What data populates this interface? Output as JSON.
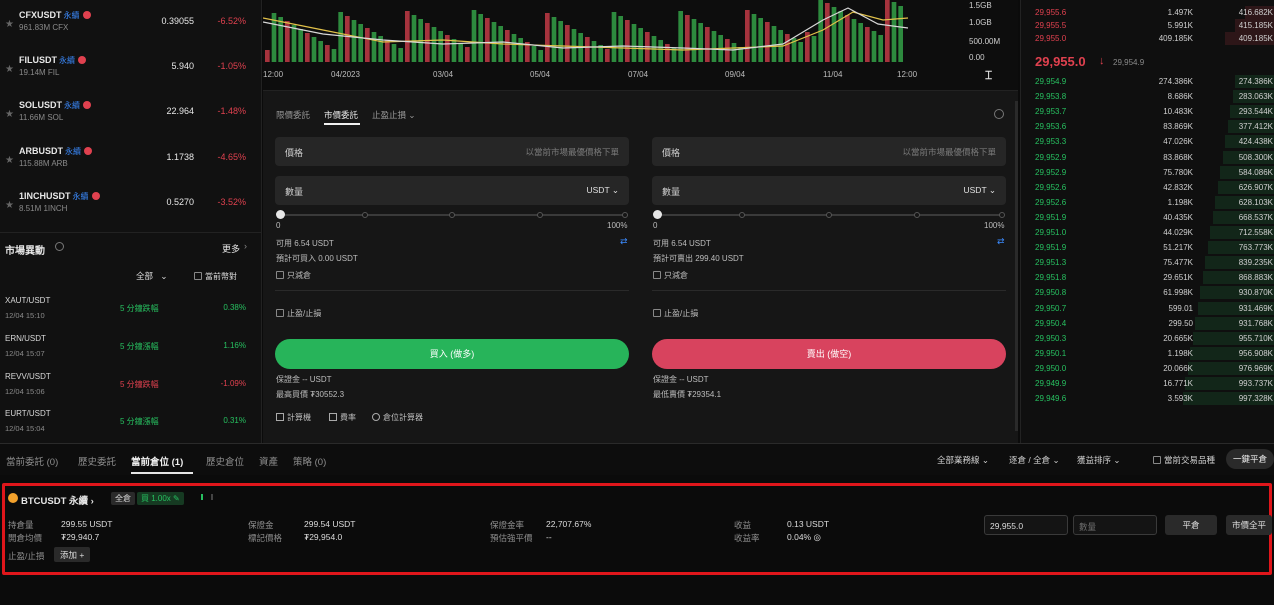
{
  "markets": [
    {
      "symbol": "CFXUSDT",
      "tag": "永續",
      "volume": "961.83M CFX",
      "price": "0.39055",
      "change": "-6.52%"
    },
    {
      "symbol": "FILUSDT",
      "tag": "永續",
      "volume": "19.14M FIL",
      "price": "5.940",
      "change": "-1.05%"
    },
    {
      "symbol": "SOLUSDT",
      "tag": "永續",
      "volume": "11.66M SOL",
      "price": "22.964",
      "change": "-1.48%"
    },
    {
      "symbol": "ARBUSDT",
      "tag": "永續",
      "volume": "115.88M ARB",
      "price": "1.1738",
      "change": "-4.65%"
    },
    {
      "symbol": "1INCHUSDT",
      "tag": "永續",
      "volume": "8.51M 1INCH",
      "price": "0.5270",
      "change": "-3.52%"
    }
  ],
  "movers": {
    "title": "市場異動",
    "more": "更多",
    "filter_all": "全部",
    "filter_current": "當前幣對",
    "rows": [
      {
        "pair": "XAUT/USDT",
        "time": "12/04 15:10",
        "desc": "5 分鐘跌幅",
        "pct": "0.38%",
        "color": "green"
      },
      {
        "pair": "ERN/USDT",
        "time": "12/04 15:07",
        "desc": "5 分鐘漲幅",
        "pct": "1.16%",
        "color": "green"
      },
      {
        "pair": "REVV/USDT",
        "time": "12/04 15:06",
        "desc": "5 分鐘跌幅",
        "pct": "-1.09%",
        "color": "red"
      },
      {
        "pair": "EURT/USDT",
        "time": "12/04 15:04",
        "desc": "5 分鐘漲幅",
        "pct": "0.31%",
        "color": "green"
      }
    ]
  },
  "chart": {
    "x_labels": [
      "12:00",
      "04/2023",
      "03/04",
      "05/04",
      "07/04",
      "09/04",
      "11/04",
      "12:00"
    ],
    "y_labels": [
      "1.5GB",
      "1.0GB",
      "500.00M",
      "0.00"
    ]
  },
  "order": {
    "tabs": [
      "限價委託",
      "市價委託",
      "止盈止損"
    ],
    "active_tab": "市價委託",
    "buy": {
      "price_label": "價格",
      "price_placeholder": "以當前市場最優價格下單",
      "qty_label": "數量",
      "unit": "USDT",
      "pct_min": "0",
      "pct_max": "100%",
      "available": "可用 6.54 USDT",
      "estimate": "預計可買入 0.00 USDT",
      "reduce_only": "只減倉",
      "tpsl": "止盈/止損",
      "button": "買入 (做多)",
      "margin": "保證金 -- USDT",
      "max_price": "最高買價 ₮30552.3"
    },
    "sell": {
      "price_label": "價格",
      "price_placeholder": "以當前市場最優價格下單",
      "qty_label": "數量",
      "unit": "USDT",
      "pct_min": "0",
      "pct_max": "100%",
      "available": "可用 6.54 USDT",
      "estimate": "預計可賣出 299.40 USDT",
      "reduce_only": "只減倉",
      "tpsl": "止盈/止損",
      "button": "賣出 (做空)",
      "margin": "保證金 -- USDT",
      "min_price": "最低賣價 ₮29354.1"
    },
    "tools": [
      "計算機",
      "費率",
      "倉位計算器"
    ]
  },
  "orderbook": {
    "asks": [
      {
        "price": "29,955.6",
        "size": "1.497K",
        "total": "416.682K"
      },
      {
        "price": "29,955.5",
        "size": "5.991K",
        "total": "415.185K"
      },
      {
        "price": "29,955.0",
        "size": "409.185K",
        "total": "409.185K"
      }
    ],
    "last_price": "29,955.0",
    "last_arrow": "↓",
    "mark_price": "29,954.9",
    "bids": [
      {
        "price": "29,954.9",
        "size": "274.386K",
        "total": "274.386K"
      },
      {
        "price": "29,953.8",
        "size": "8.686K",
        "total": "283.063K"
      },
      {
        "price": "29,953.7",
        "size": "10.483K",
        "total": "293.544K"
      },
      {
        "price": "29,953.6",
        "size": "83.869K",
        "total": "377.412K"
      },
      {
        "price": "29,953.3",
        "size": "47.026K",
        "total": "424.438K"
      },
      {
        "price": "29,952.9",
        "size": "83.868K",
        "total": "508.300K"
      },
      {
        "price": "29,952.9",
        "size": "75.780K",
        "total": "584.086K"
      },
      {
        "price": "29,952.6",
        "size": "42.832K",
        "total": "626.907K"
      },
      {
        "price": "29,952.6",
        "size": "1.198K",
        "total": "628.103K"
      },
      {
        "price": "29,951.9",
        "size": "40.435K",
        "total": "668.537K"
      },
      {
        "price": "29,951.0",
        "size": "44.029K",
        "total": "712.558K"
      },
      {
        "price": "29,951.9",
        "size": "51.217K",
        "total": "763.773K"
      },
      {
        "price": "29,951.3",
        "size": "75.477K",
        "total": "839.235K"
      },
      {
        "price": "29,951.8",
        "size": "29.651K",
        "total": "868.883K"
      },
      {
        "price": "29,950.8",
        "size": "61.998K",
        "total": "930.870K"
      },
      {
        "price": "29,950.7",
        "size": "599.01",
        "total": "931.469K"
      },
      {
        "price": "29,950.4",
        "size": "299.50",
        "total": "931.768K"
      },
      {
        "price": "29,950.3",
        "size": "20.665K",
        "total": "955.710K"
      },
      {
        "price": "29,950.1",
        "size": "1.198K",
        "total": "956.908K"
      },
      {
        "price": "29,950.0",
        "size": "20.066K",
        "total": "976.969K"
      },
      {
        "price": "29,949.9",
        "size": "16.771K",
        "total": "993.737K"
      },
      {
        "price": "29,949.6",
        "size": "3.593K",
        "total": "997.328K"
      }
    ]
  },
  "bottom_tabs": {
    "tabs": [
      "當前委託 (0)",
      "歷史委託",
      "當前倉位 (1)",
      "歷史倉位",
      "資產",
      "策略 (0)"
    ],
    "active": "當前倉位 (1)",
    "filters": [
      "全部業務線",
      "逐倉 / 全倉",
      "獲益排序"
    ],
    "current_only": "當前交易品種",
    "close_all": "一鍵平倉"
  },
  "position": {
    "symbol": "BTCUSDT 永續",
    "mode": "全倉",
    "leverage": "買 1.00x",
    "labels": {
      "size": "持倉量",
      "entry": "開倉均價",
      "margin": "保證金",
      "mark": "標記價格",
      "margin_ratio": "保證金率",
      "liq": "預估強平價",
      "pnl": "收益",
      "roe": "收益率",
      "tpsl": "止盈/止損"
    },
    "values": {
      "size": "299.55 USDT",
      "entry": "₮29,940.7",
      "margin": "299.54 USDT",
      "mark": "₮29,954.0",
      "margin_ratio": "22,707.67%",
      "liq": "--",
      "pnl": "0.13 USDT",
      "roe": "0.04%"
    },
    "add": "添加",
    "price_input": "29,955.0",
    "qty_placeholder": "數量",
    "close": "平倉",
    "market_close": "市價全平"
  },
  "colors": {
    "up": "#27c060",
    "down": "#e0414f",
    "highlight": "#e0161b"
  }
}
